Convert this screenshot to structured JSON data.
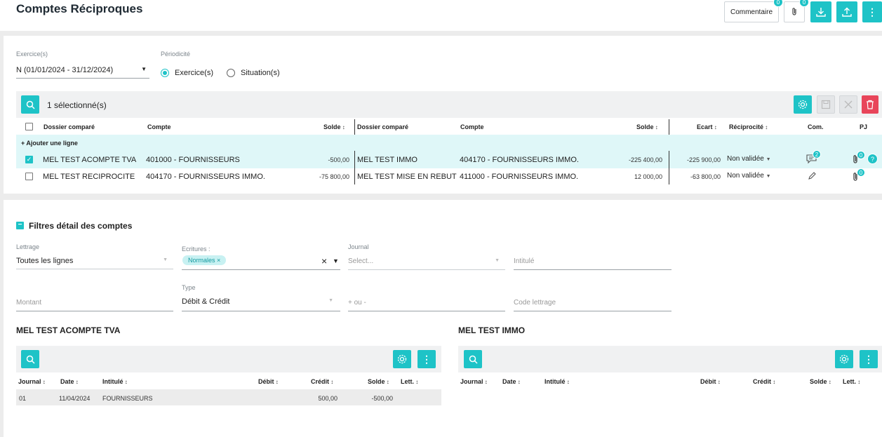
{
  "header": {
    "title": "Comptes Réciproques",
    "comment_label": "Commentaire",
    "badge_comment": "0",
    "badge_attach": "0"
  },
  "filters": {
    "exercice_label": "Exercice(s)",
    "exercice_value": "N (01/01/2024 - 31/12/2024)",
    "periodicite_label": "Périodicité",
    "radio_exercice": "Exercice(s)",
    "radio_situation": "Situation(s)"
  },
  "table": {
    "selected_count": "1 sélectionné(s)",
    "add_line": "+ Ajouter une ligne",
    "headers": {
      "dossier": "Dossier comparé",
      "compte": "Compte",
      "solde": "Solde",
      "dossier2": "Dossier comparé",
      "compte2": "Compte",
      "solde2": "Solde",
      "ecart": "Ecart",
      "reciprocite": "Réciprocité",
      "com": "Com.",
      "pj": "PJ"
    },
    "rows": [
      {
        "dossier": "MEL TEST ACOMPTE TVA",
        "compte": "401000 - FOURNISSEURS",
        "solde": "-500,00",
        "dossier2": "MEL TEST IMMO",
        "compte2": "404170 - FOURNISSEURS IMMO.",
        "solde2": "-225 400,00",
        "ecart": "-225 900,00",
        "reciprocite": "Non validée",
        "com_badge": "2",
        "pj_badge": "0",
        "extra_badge": "?"
      },
      {
        "dossier": "MEL TEST RECIPROCITE",
        "compte": "404170 - FOURNISSEURS IMMO.",
        "solde": "-75 800,00",
        "dossier2": "MEL TEST MISE EN REBUT",
        "compte2": "411000 - FOURNISSEURS IMMO.",
        "solde2": "12 000,00",
        "ecart": "-63 800,00",
        "reciprocite": "Non validée",
        "pj_badge": "0"
      }
    ]
  },
  "detail": {
    "section_title": "Filtres détail des comptes",
    "lettrage_label": "Lettrage",
    "lettrage_value": "Toutes les lignes",
    "ecritures_label": "Ecritures :",
    "ecritures_chip": "Normales",
    "journal_label": "Journal",
    "journal_placeholder": "Select...",
    "intitule_placeholder": "Intitulé",
    "montant_placeholder": "Montant",
    "type_label": "Type",
    "type_value": "Débit & Crédit",
    "plusminus_placeholder": "+ ou -",
    "code_lettrage_placeholder": "Code lettrage"
  },
  "left_table": {
    "title": "MEL TEST ACOMPTE TVA",
    "headers": [
      "Journal",
      "Date",
      "Intitulé",
      "Débit",
      "Crédit",
      "Solde",
      "Lett."
    ],
    "row": {
      "journal": "01",
      "date": "11/04/2024",
      "intitule": "FOURNISSEURS",
      "debit": "",
      "credit": "500,00",
      "solde": "-500,00",
      "lett": ""
    }
  },
  "right_table": {
    "title": "MEL TEST IMMO",
    "headers": [
      "Journal",
      "Date",
      "Intitulé",
      "Débit",
      "Crédit",
      "Solde",
      "Lett."
    ]
  },
  "colors": {
    "accent": "#1ec3c7",
    "danger": "#e8455a",
    "selected_row": "#dff7f8"
  }
}
